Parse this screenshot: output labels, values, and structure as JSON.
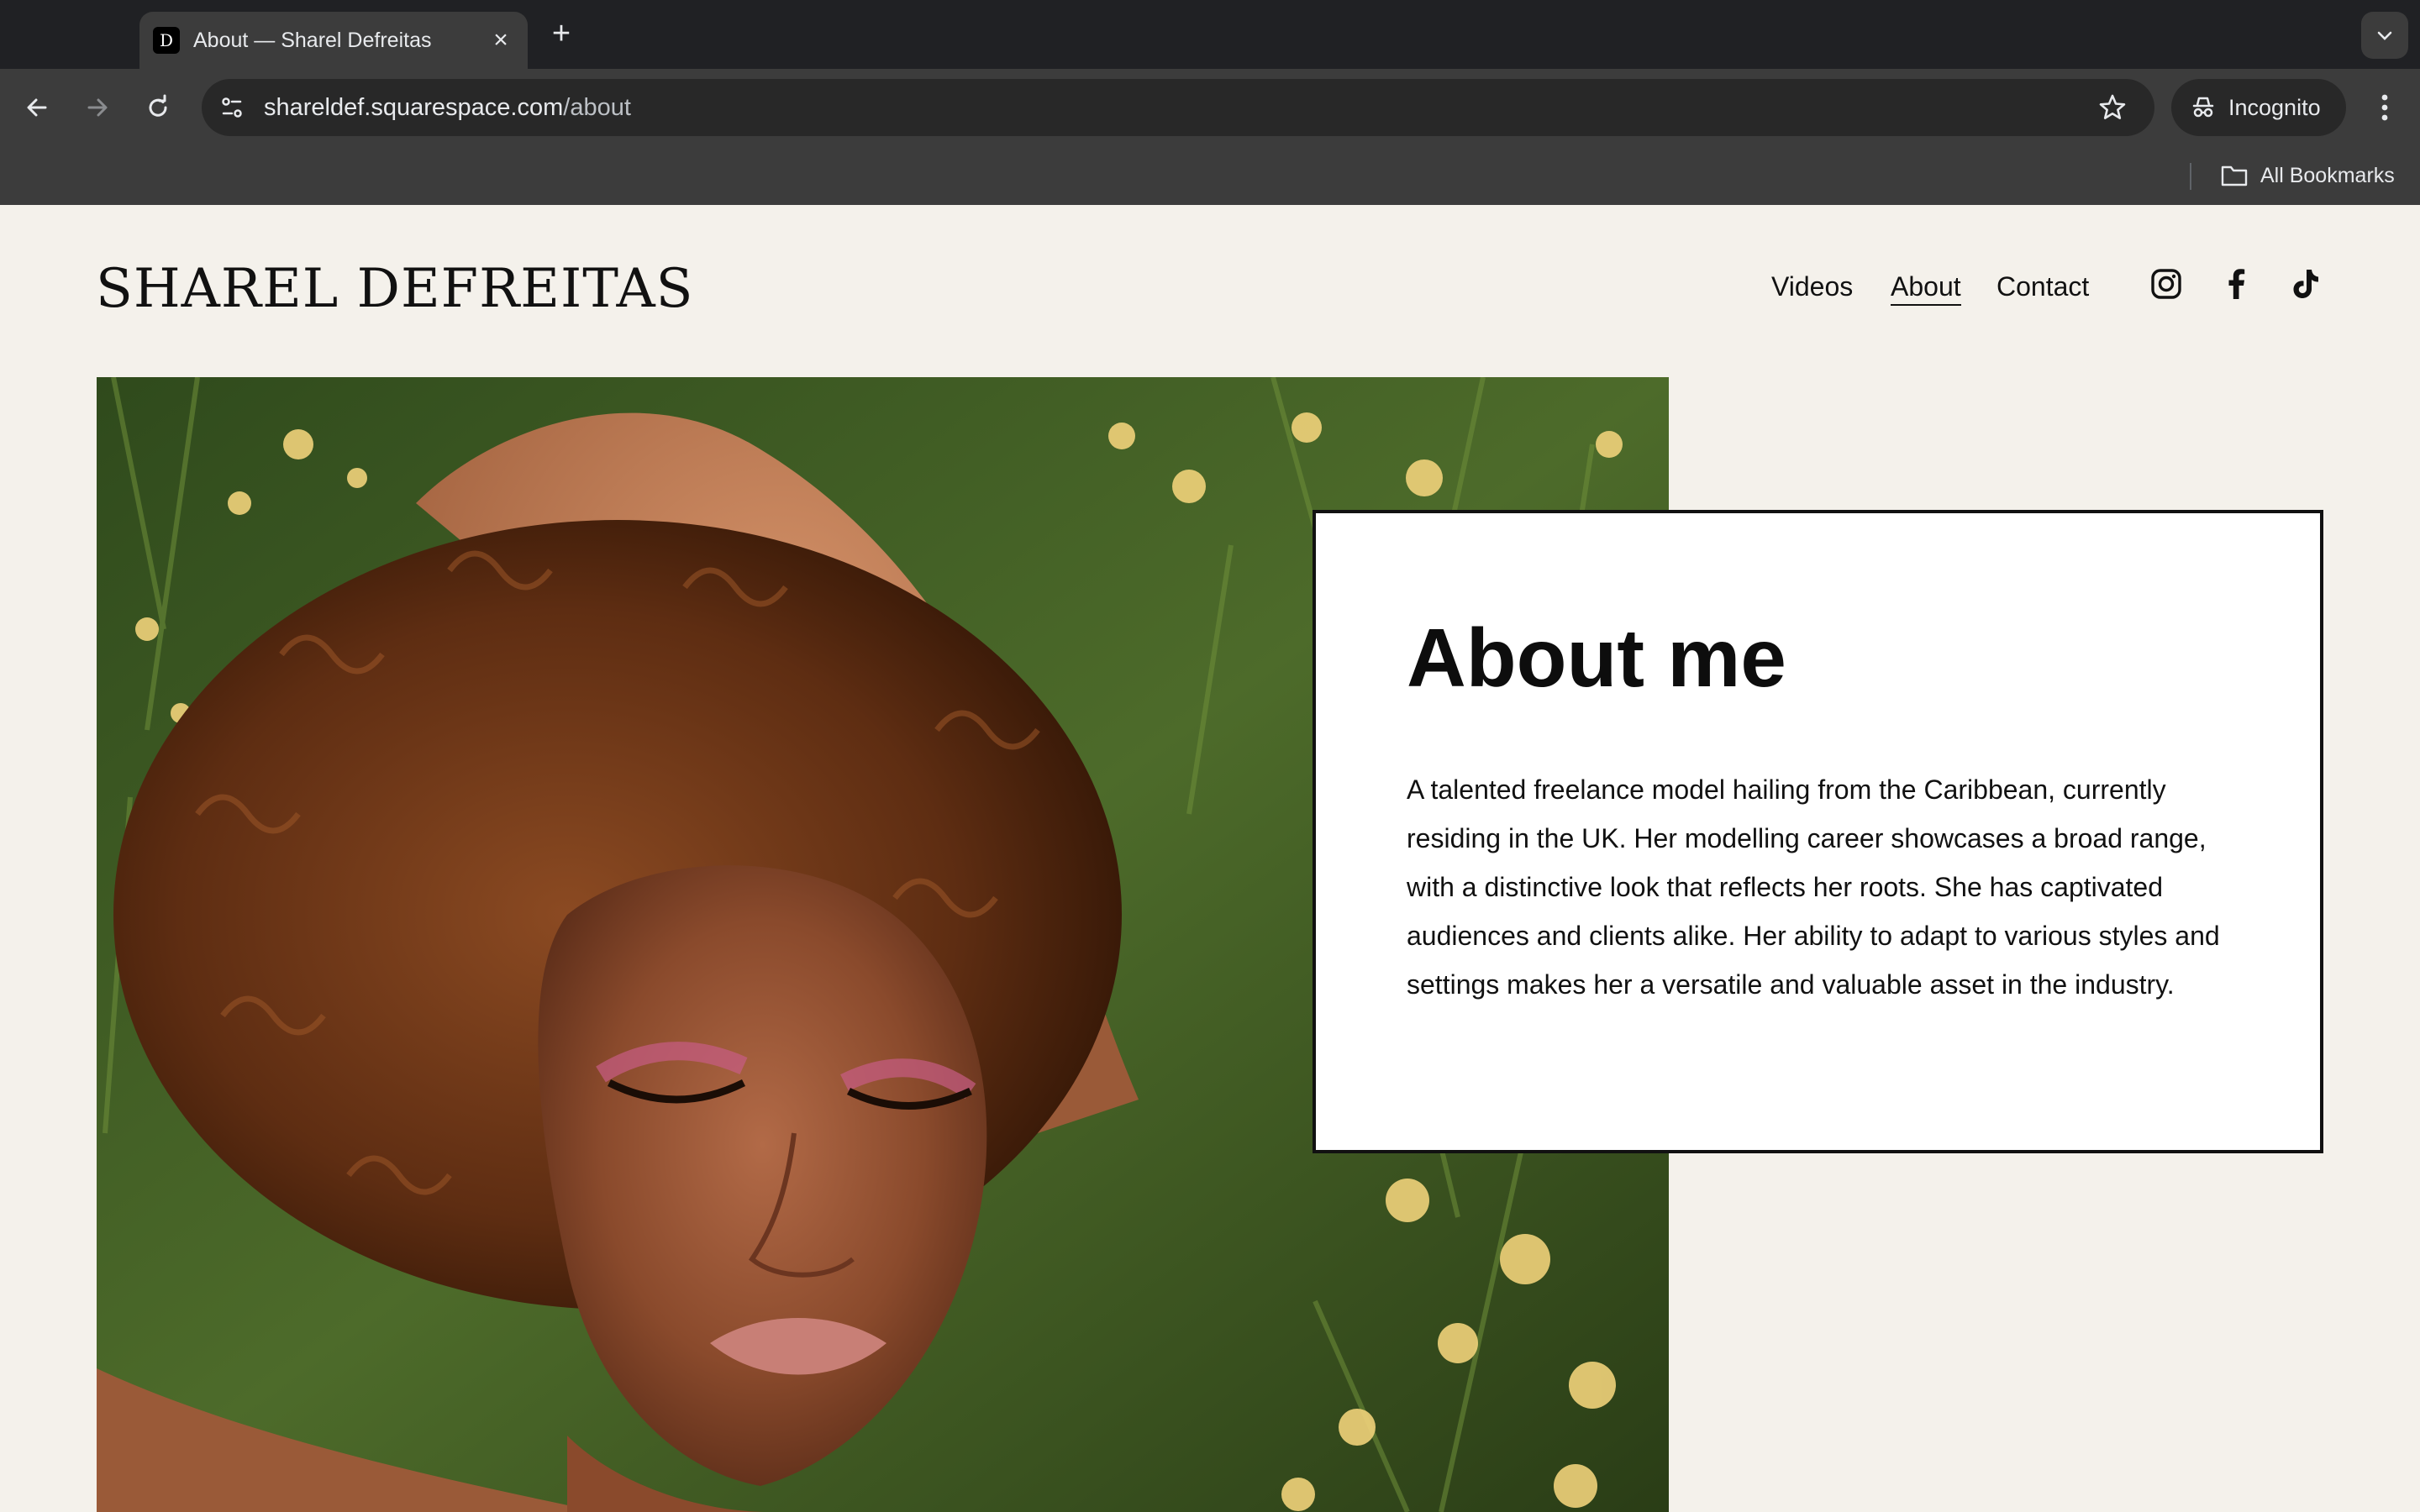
{
  "browser": {
    "tab": {
      "title": "About — Sharel Defreitas",
      "favicon_letter": "D"
    },
    "url": {
      "host": "shareldef.squarespace.com",
      "path": "/about"
    },
    "incognito_label": "Incognito",
    "bookmarks_label": "All Bookmarks"
  },
  "site": {
    "logo": "SHAREL DEFREITAS",
    "nav": [
      {
        "label": "Videos",
        "active": false
      },
      {
        "label": "About",
        "active": true
      },
      {
        "label": "Contact",
        "active": false
      }
    ],
    "social_icons": [
      "instagram-icon",
      "facebook-icon",
      "tiktok-icon"
    ]
  },
  "about": {
    "title": "About me",
    "body": "A talented freelance model hailing from the Caribbean, currently residing in the UK. Her modelling career showcases a broad range, with a distinctive look that reflects her roots. She has captivated audiences and clients alike. Her ability to adapt to various styles and settings makes her a versatile and valuable asset in the industry."
  },
  "colors": {
    "page_background": "#f4f1eb",
    "chrome_dark": "#202124",
    "chrome_toolbar": "#3c3c3c",
    "text": "#111111"
  }
}
